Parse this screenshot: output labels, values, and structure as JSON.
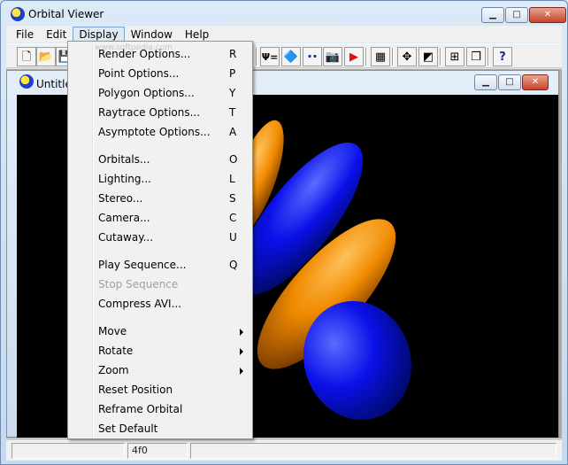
{
  "app": {
    "title": "Orbital Viewer",
    "icon": "orbital-app-icon"
  },
  "window_controls": {
    "minimize": "▁",
    "maximize": "□",
    "close": "✕"
  },
  "menubar": {
    "items": [
      {
        "label": "File"
      },
      {
        "label": "Edit"
      },
      {
        "label": "Display"
      },
      {
        "label": "Window"
      },
      {
        "label": "Help"
      }
    ],
    "open_item": "Display"
  },
  "toolbar": {
    "buttons": [
      {
        "name": "new-file-icon",
        "glyph": "🗋"
      },
      {
        "name": "open-folder-icon",
        "glyph": "📂"
      },
      {
        "name": "save-icon",
        "glyph": "💾"
      },
      {
        "name": "psi-function-icon",
        "glyph": "Ψ="
      },
      {
        "name": "prism-icon",
        "glyph": "🔷"
      },
      {
        "name": "atoms-icon",
        "glyph": "⚫⚫"
      },
      {
        "name": "camera-icon",
        "glyph": "📷"
      },
      {
        "name": "record-icon",
        "glyph": "▶"
      },
      {
        "name": "color-palette-icon",
        "glyph": "▦"
      },
      {
        "name": "move-arrows-icon",
        "glyph": "✥"
      },
      {
        "name": "tile-icon",
        "glyph": "◩"
      },
      {
        "name": "tile-horizontal-icon",
        "glyph": "⊞"
      },
      {
        "name": "cascade-icon",
        "glyph": "❐"
      },
      {
        "name": "help-icon",
        "glyph": "?"
      }
    ]
  },
  "child_window": {
    "title": "Untitle"
  },
  "display_menu": {
    "watermark": "www.softpedia.com",
    "items": [
      {
        "label": "Render Options...",
        "shortcut": "R",
        "disabled": false,
        "submenu": false
      },
      {
        "label": "Point Options...",
        "shortcut": "P",
        "disabled": false,
        "submenu": false
      },
      {
        "label": "Polygon Options...",
        "shortcut": "Y",
        "disabled": false,
        "submenu": false
      },
      {
        "label": "Raytrace Options...",
        "shortcut": "T",
        "disabled": false,
        "submenu": false
      },
      {
        "label": "Asymptote Options...",
        "shortcut": "A",
        "disabled": false,
        "submenu": false
      },
      {
        "label": "Orbitals...",
        "shortcut": "O",
        "disabled": false,
        "submenu": false
      },
      {
        "label": "Lighting...",
        "shortcut": "L",
        "disabled": false,
        "submenu": false
      },
      {
        "label": "Stereo...",
        "shortcut": "S",
        "disabled": false,
        "submenu": false
      },
      {
        "label": "Camera...",
        "shortcut": "C",
        "disabled": false,
        "submenu": false
      },
      {
        "label": "Cutaway...",
        "shortcut": "U",
        "disabled": false,
        "submenu": false
      },
      {
        "label": "Play Sequence...",
        "shortcut": "Q",
        "disabled": false,
        "submenu": false
      },
      {
        "label": "Stop Sequence",
        "shortcut": "",
        "disabled": true,
        "submenu": false
      },
      {
        "label": "Compress AVI...",
        "shortcut": "",
        "disabled": false,
        "submenu": false
      },
      {
        "label": "Move",
        "shortcut": "",
        "disabled": false,
        "submenu": true
      },
      {
        "label": "Rotate",
        "shortcut": "",
        "disabled": false,
        "submenu": true
      },
      {
        "label": "Zoom",
        "shortcut": "",
        "disabled": false,
        "submenu": true
      },
      {
        "label": "Reset Position",
        "shortcut": "",
        "disabled": false,
        "submenu": false
      },
      {
        "label": "Reframe Orbital",
        "shortcut": "",
        "disabled": false,
        "submenu": false
      },
      {
        "label": "Set Default",
        "shortcut": "",
        "disabled": false,
        "submenu": false
      }
    ]
  },
  "statusbar": {
    "panes": [
      "",
      "4f0",
      ""
    ]
  },
  "colors": {
    "lobe_positive": "#f08a00",
    "lobe_negative": "#0a10e8",
    "viewport_background": "#000000",
    "menu_highlight": "#dfe9f6"
  }
}
